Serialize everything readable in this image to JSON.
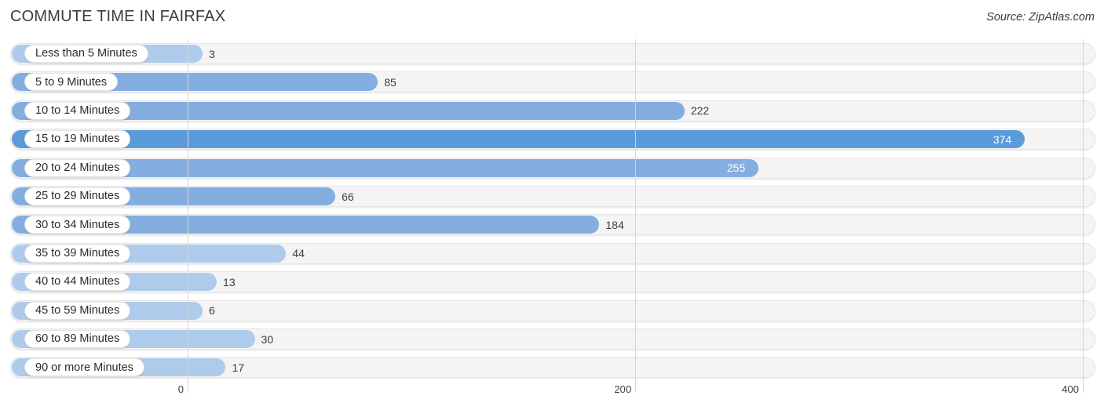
{
  "header": {
    "title": "COMMUTE TIME IN FAIRFAX",
    "source": "Source: ZipAtlas.com"
  },
  "colors": {
    "bar_light": "#AFCBEC",
    "bar_mid": "#84AEE0",
    "bar_dark": "#5B9BD9",
    "track": "#F4F4F4",
    "gridline": "#D5D5D5",
    "text": "#3C3C3C",
    "value_inside": "#FFFFFF"
  },
  "chart_data": {
    "type": "bar",
    "orientation": "horizontal",
    "title": "COMMUTE TIME IN FAIRFAX",
    "xlabel": "",
    "ylabel": "",
    "xlim": [
      0,
      400
    ],
    "xticks": [
      0,
      200,
      400
    ],
    "xtick_labels": [
      "0",
      "200",
      "400"
    ],
    "grid": true,
    "legend": null,
    "categories": [
      "Less than 5 Minutes",
      "5 to 9 Minutes",
      "10 to 14 Minutes",
      "15 to 19 Minutes",
      "20 to 24 Minutes",
      "25 to 29 Minutes",
      "30 to 34 Minutes",
      "35 to 39 Minutes",
      "40 to 44 Minutes",
      "45 to 59 Minutes",
      "60 to 89 Minutes",
      "90 or more Minutes"
    ],
    "values": [
      3,
      85,
      222,
      374,
      255,
      66,
      184,
      44,
      13,
      6,
      30,
      17
    ],
    "value_labels": [
      "3",
      "85",
      "222",
      "374",
      "255",
      "66",
      "184",
      "44",
      "13",
      "6",
      "30",
      "17"
    ],
    "label_inside": [
      false,
      false,
      false,
      true,
      true,
      false,
      false,
      false,
      false,
      false,
      false,
      false
    ]
  }
}
